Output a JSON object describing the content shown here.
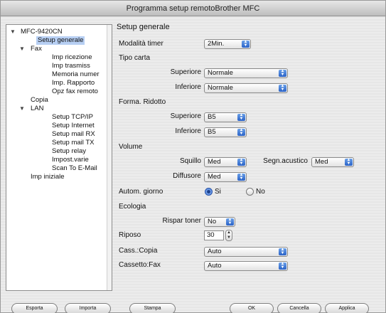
{
  "window": {
    "title": "Programma setup remotoBrother MFC"
  },
  "tree": {
    "items": [
      {
        "label": "MFC-9420CN",
        "expanded": true
      },
      {
        "label": "Setup generale",
        "selected": true
      },
      {
        "label": "Fax",
        "expanded": true
      },
      {
        "label": "Imp ricezione"
      },
      {
        "label": "Imp trasmiss"
      },
      {
        "label": "Memoria numer"
      },
      {
        "label": "Imp. Rapporto"
      },
      {
        "label": "Opz fax remoto"
      },
      {
        "label": "Copia"
      },
      {
        "label": "LAN",
        "expanded": true
      },
      {
        "label": "Setup TCP/IP"
      },
      {
        "label": "Setup Internet"
      },
      {
        "label": "Setup mail RX"
      },
      {
        "label": "Setup mail TX"
      },
      {
        "label": "Setup relay"
      },
      {
        "label": "Impost.varie"
      },
      {
        "label": "Scan To E-Mail"
      },
      {
        "label": "Imp iniziale"
      }
    ]
  },
  "main": {
    "section_title": "Setup generale",
    "mode_timer": {
      "label": "Modalità timer",
      "value": "2Min."
    },
    "paper_type": {
      "label": "Tipo carta",
      "upper": {
        "label": "Superiore",
        "value": "Normale"
      },
      "lower": {
        "label": "Inferiore",
        "value": "Normale"
      }
    },
    "paper_size": {
      "label": "Forma. Ridotto",
      "upper": {
        "label": "Superiore",
        "value": "B5"
      },
      "lower": {
        "label": "Inferiore",
        "value": "B5"
      }
    },
    "volume": {
      "label": "Volume",
      "ring": {
        "label": "Squillo",
        "value": "Med"
      },
      "beeper": {
        "label": "Segn.acustico",
        "value": "Med"
      },
      "speaker": {
        "label": "Diffusore",
        "value": "Med"
      }
    },
    "auto_daylight": {
      "label": "Autom. giorno",
      "yes": "Si",
      "no": "No",
      "selected": "Si"
    },
    "ecology": {
      "label": "Ecologia",
      "toner_save": {
        "label": "Rispar toner",
        "value": "No"
      }
    },
    "sleep": {
      "label": "Riposo",
      "value": "30"
    },
    "tray_copy": {
      "label": "Cass.:Copia",
      "value": "Auto"
    },
    "tray_fax": {
      "label": "Cassetto:Fax",
      "value": "Auto"
    }
  },
  "buttons": {
    "export": "Esporta",
    "import": "Importa",
    "print": "Stampa",
    "ok": "OK",
    "cancel": "Cancella",
    "apply": "Applica"
  }
}
